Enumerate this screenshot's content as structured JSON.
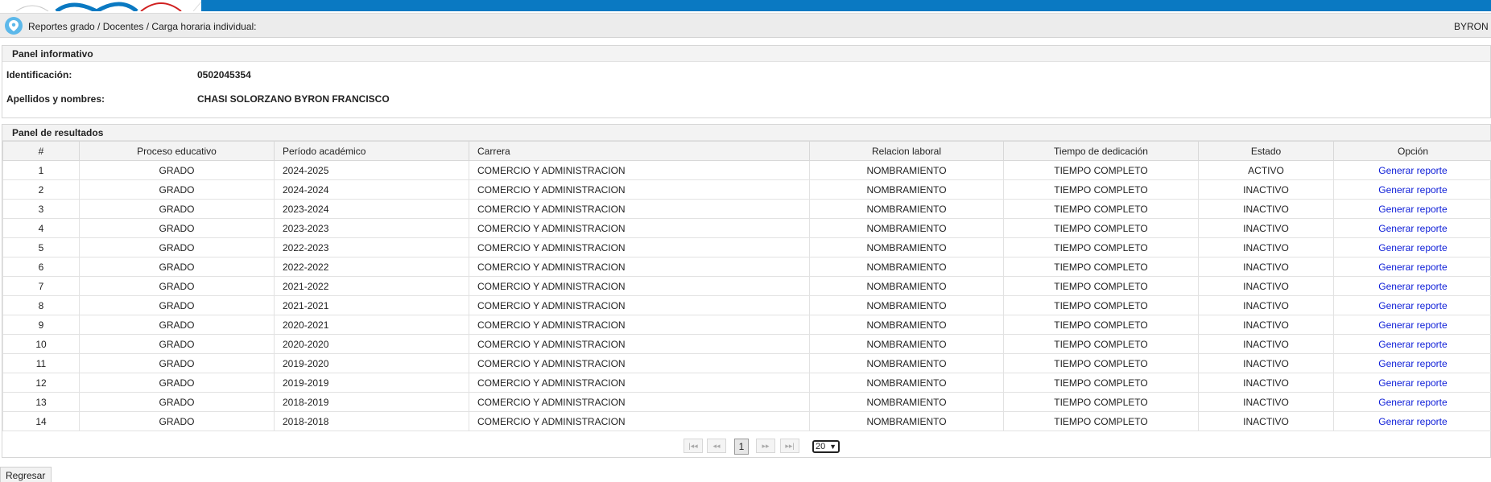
{
  "breadcrumb": {
    "text": "Reportes grado / Docentes / Carga horaria individual:",
    "user": "BYRON C"
  },
  "info_panel": {
    "title": "Panel informativo",
    "id_label": "Identificación:",
    "id_value": "0502045354",
    "name_label": "Apellidos y nombres:",
    "name_value": "CHASI SOLORZANO BYRON FRANCISCO"
  },
  "results_panel": {
    "title": "Panel de resultados",
    "columns": [
      "#",
      "Proceso educativo",
      "Período académico",
      "Carrera",
      "Relacion laboral",
      "Tiempo de dedicación",
      "Estado",
      "Opción"
    ],
    "rows": [
      [
        "1",
        "GRADO",
        "2024-2025",
        "COMERCIO Y ADMINISTRACION",
        "NOMBRAMIENTO",
        "TIEMPO COMPLETO",
        "ACTIVO",
        "Generar reporte"
      ],
      [
        "2",
        "GRADO",
        "2024-2024",
        "COMERCIO Y ADMINISTRACION",
        "NOMBRAMIENTO",
        "TIEMPO COMPLETO",
        "INACTIVO",
        "Generar reporte"
      ],
      [
        "3",
        "GRADO",
        "2023-2024",
        "COMERCIO Y ADMINISTRACION",
        "NOMBRAMIENTO",
        "TIEMPO COMPLETO",
        "INACTIVO",
        "Generar reporte"
      ],
      [
        "4",
        "GRADO",
        "2023-2023",
        "COMERCIO Y ADMINISTRACION",
        "NOMBRAMIENTO",
        "TIEMPO COMPLETO",
        "INACTIVO",
        "Generar reporte"
      ],
      [
        "5",
        "GRADO",
        "2022-2023",
        "COMERCIO Y ADMINISTRACION",
        "NOMBRAMIENTO",
        "TIEMPO COMPLETO",
        "INACTIVO",
        "Generar reporte"
      ],
      [
        "6",
        "GRADO",
        "2022-2022",
        "COMERCIO Y ADMINISTRACION",
        "NOMBRAMIENTO",
        "TIEMPO COMPLETO",
        "INACTIVO",
        "Generar reporte"
      ],
      [
        "7",
        "GRADO",
        "2021-2022",
        "COMERCIO Y ADMINISTRACION",
        "NOMBRAMIENTO",
        "TIEMPO COMPLETO",
        "INACTIVO",
        "Generar reporte"
      ],
      [
        "8",
        "GRADO",
        "2021-2021",
        "COMERCIO Y ADMINISTRACION",
        "NOMBRAMIENTO",
        "TIEMPO COMPLETO",
        "INACTIVO",
        "Generar reporte"
      ],
      [
        "9",
        "GRADO",
        "2020-2021",
        "COMERCIO Y ADMINISTRACION",
        "NOMBRAMIENTO",
        "TIEMPO COMPLETO",
        "INACTIVO",
        "Generar reporte"
      ],
      [
        "10",
        "GRADO",
        "2020-2020",
        "COMERCIO Y ADMINISTRACION",
        "NOMBRAMIENTO",
        "TIEMPO COMPLETO",
        "INACTIVO",
        "Generar reporte"
      ],
      [
        "11",
        "GRADO",
        "2019-2020",
        "COMERCIO Y ADMINISTRACION",
        "NOMBRAMIENTO",
        "TIEMPO COMPLETO",
        "INACTIVO",
        "Generar reporte"
      ],
      [
        "12",
        "GRADO",
        "2019-2019",
        "COMERCIO Y ADMINISTRACION",
        "NOMBRAMIENTO",
        "TIEMPO COMPLETO",
        "INACTIVO",
        "Generar reporte"
      ],
      [
        "13",
        "GRADO",
        "2018-2019",
        "COMERCIO Y ADMINISTRACION",
        "NOMBRAMIENTO",
        "TIEMPO COMPLETO",
        "INACTIVO",
        "Generar reporte"
      ],
      [
        "14",
        "GRADO",
        "2018-2018",
        "COMERCIO Y ADMINISTRACION",
        "NOMBRAMIENTO",
        "TIEMPO COMPLETO",
        "INACTIVO",
        "Generar reporte"
      ]
    ]
  },
  "pagination": {
    "first_label": "|◂◂",
    "prev_label": "◂◂",
    "current_page": "1",
    "next_label": "▸▸",
    "last_label": "▸▸|",
    "page_size": "20"
  },
  "back_button": "Regresar",
  "colors": {
    "brand_bar": "#0a79c2",
    "pin": "#5cb8ea",
    "link": "#1020d8"
  }
}
